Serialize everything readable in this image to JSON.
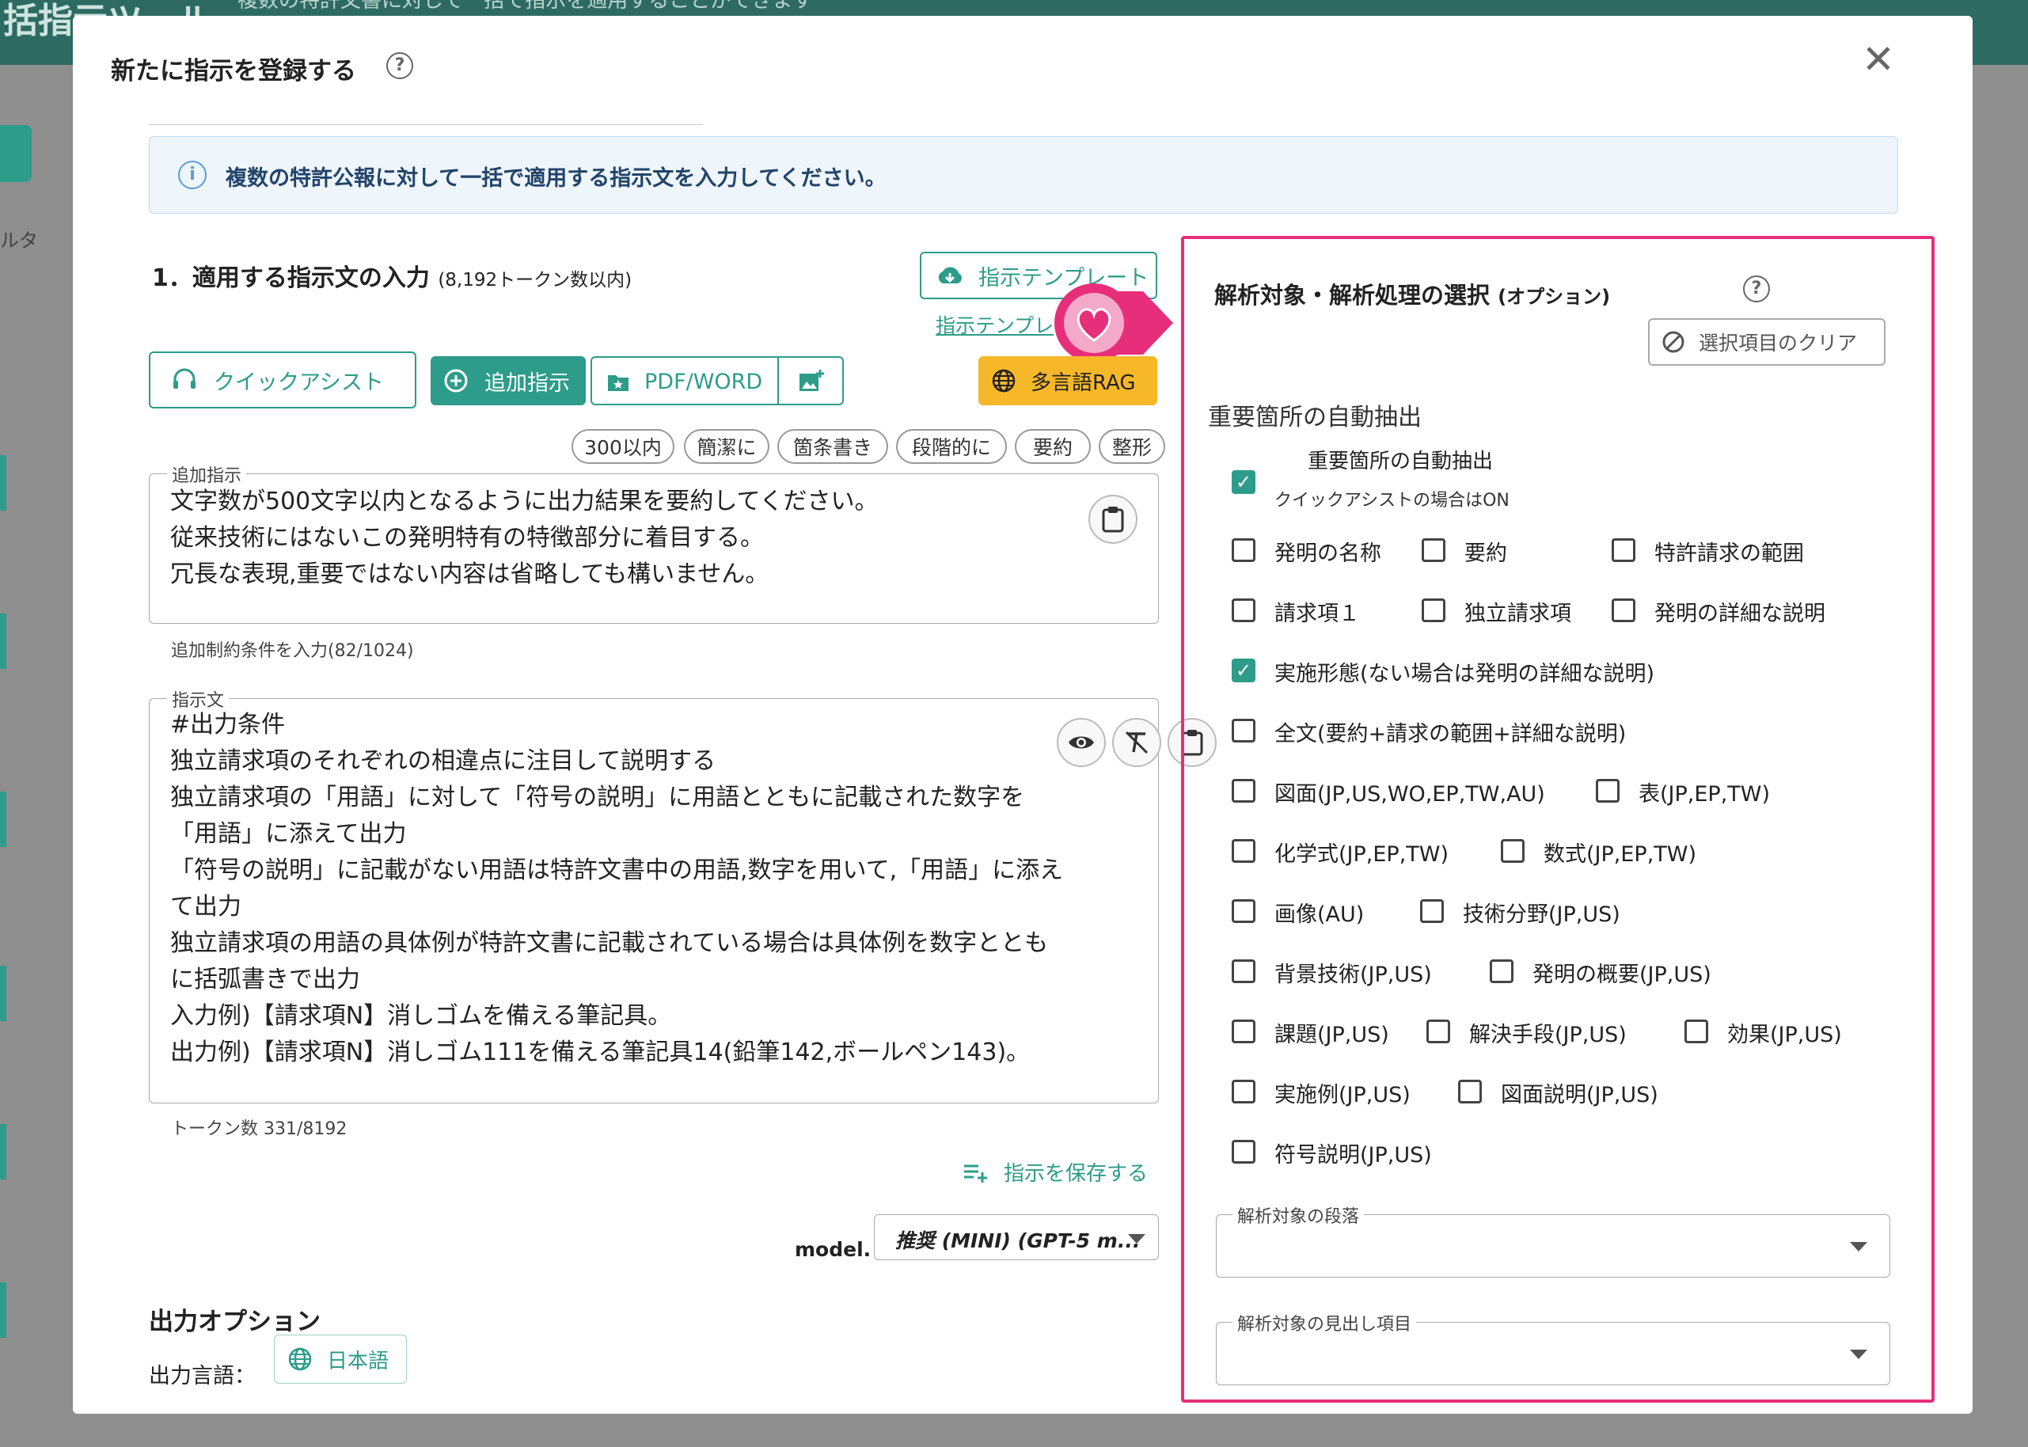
{
  "background": {
    "title": "括指示ツール",
    "desc": "複数の特許文書に対して一括で指示を適用することができます",
    "filter_label": "ルタ"
  },
  "modal": {
    "title": "新たに指示を登録する",
    "info": "複数の特許公報に対して一括で適用する指示文を入力してください。",
    "section1": {
      "title": "1．適用する指示文の入力",
      "sub": "(8,192トークン数以内)"
    },
    "template_button": "指示テンプレート",
    "template_link": "指示テンプレ",
    "toolbar": {
      "quick_assist": "クイックアシスト",
      "add_instruction": "追加指示",
      "pdf_word": "PDF/WORD",
      "multilang": "多言語RAG"
    },
    "chips": [
      "300以内",
      "簡潔に",
      "箇条書き",
      "段階的に",
      "要約",
      "整形"
    ],
    "additional": {
      "label": "追加指示",
      "lines": [
        "文字数が500文字以内となるように出力結果を要約してください。",
        "従来技術にはないこの発明特有の特徴部分に着目する。",
        "冗長な表現,重要ではない内容は省略しても構いません。"
      ],
      "helper": "追加制約条件を入力(82/1024)"
    },
    "instruction": {
      "label": "指示文",
      "lines": [
        "#出力条件",
        "独立請求項のそれぞれの相違点に注目して説明する",
        "独立請求項の「用語」に対して「符号の説明」に用語とともに記載された数字を",
        "「用語」に添えて出力",
        "「符号の説明」に記載がない用語は特許文書中の用語,数字を用いて,「用語」に添え",
        "て出力",
        "独立請求項の用語の具体例が特許文書に記載されている場合は具体例を数字ととも",
        "に括弧書きで出力",
        "入力例)【請求項N】消しゴムを備える筆記具。",
        "出力例)【請求項N】消しゴム111を備える筆記具14(鉛筆142,ボールペン143)。"
      ],
      "helper": "トークン数 331/8192"
    },
    "save_link": "指示を保存する",
    "model": {
      "label": "model.",
      "value": "推奨 (MINI) (GPT-5 m..."
    },
    "output": {
      "title": "出力オプション",
      "lang_label": "出力言語：",
      "lang_value": "日本語"
    },
    "panel": {
      "title": "解析対象・解析処理の選択",
      "title_suffix": "(オプション)",
      "clear_button": "選択項目のクリア",
      "auto_heading": "重要箇所の自動抽出",
      "auto_label": "重要箇所の自動抽出",
      "auto_sub": "クイックアシストの場合はON",
      "rows": [
        [
          {
            "label": "発明の名称",
            "checked": false
          },
          {
            "label": "要約",
            "checked": false
          },
          {
            "label": "特許請求の範囲",
            "checked": false
          }
        ],
        [
          {
            "label": "請求項１",
            "checked": false
          },
          {
            "label": "独立請求項",
            "checked": false
          },
          {
            "label": "発明の詳細な説明",
            "checked": false
          }
        ],
        [
          {
            "label": "実施形態(ない場合は発明の詳細な説明)",
            "checked": true
          }
        ],
        [
          {
            "label": "全文(要約+請求の範囲+詳細な説明)",
            "checked": false
          }
        ],
        [
          {
            "label": "図面(JP,US,WO,EP,TW,AU)",
            "checked": false
          },
          {
            "label": "表(JP,EP,TW)",
            "checked": false
          }
        ],
        [
          {
            "label": "化学式(JP,EP,TW)",
            "checked": false
          },
          {
            "label": "数式(JP,EP,TW)",
            "checked": false
          }
        ],
        [
          {
            "label": "画像(AU)",
            "checked": false
          },
          {
            "label": "技術分野(JP,US)",
            "checked": false
          }
        ],
        [
          {
            "label": "背景技術(JP,US)",
            "checked": false
          },
          {
            "label": "発明の概要(JP,US)",
            "checked": false
          }
        ],
        [
          {
            "label": "課題(JP,US)",
            "checked": false
          },
          {
            "label": "解決手段(JP,US)",
            "checked": false
          },
          {
            "label": "効果(JP,US)",
            "checked": false
          }
        ],
        [
          {
            "label": "実施例(JP,US)",
            "checked": false
          },
          {
            "label": "図面説明(JP,US)",
            "checked": false
          }
        ],
        [
          {
            "label": "符号説明(JP,US)",
            "checked": false
          }
        ]
      ],
      "select1_label": "解析対象の段落",
      "select2_label": "解析対象の見出し項目"
    }
  },
  "colors": {
    "accent": "#2d9c8a",
    "highlight": "#e72e7b",
    "cta": "#f6b829"
  }
}
